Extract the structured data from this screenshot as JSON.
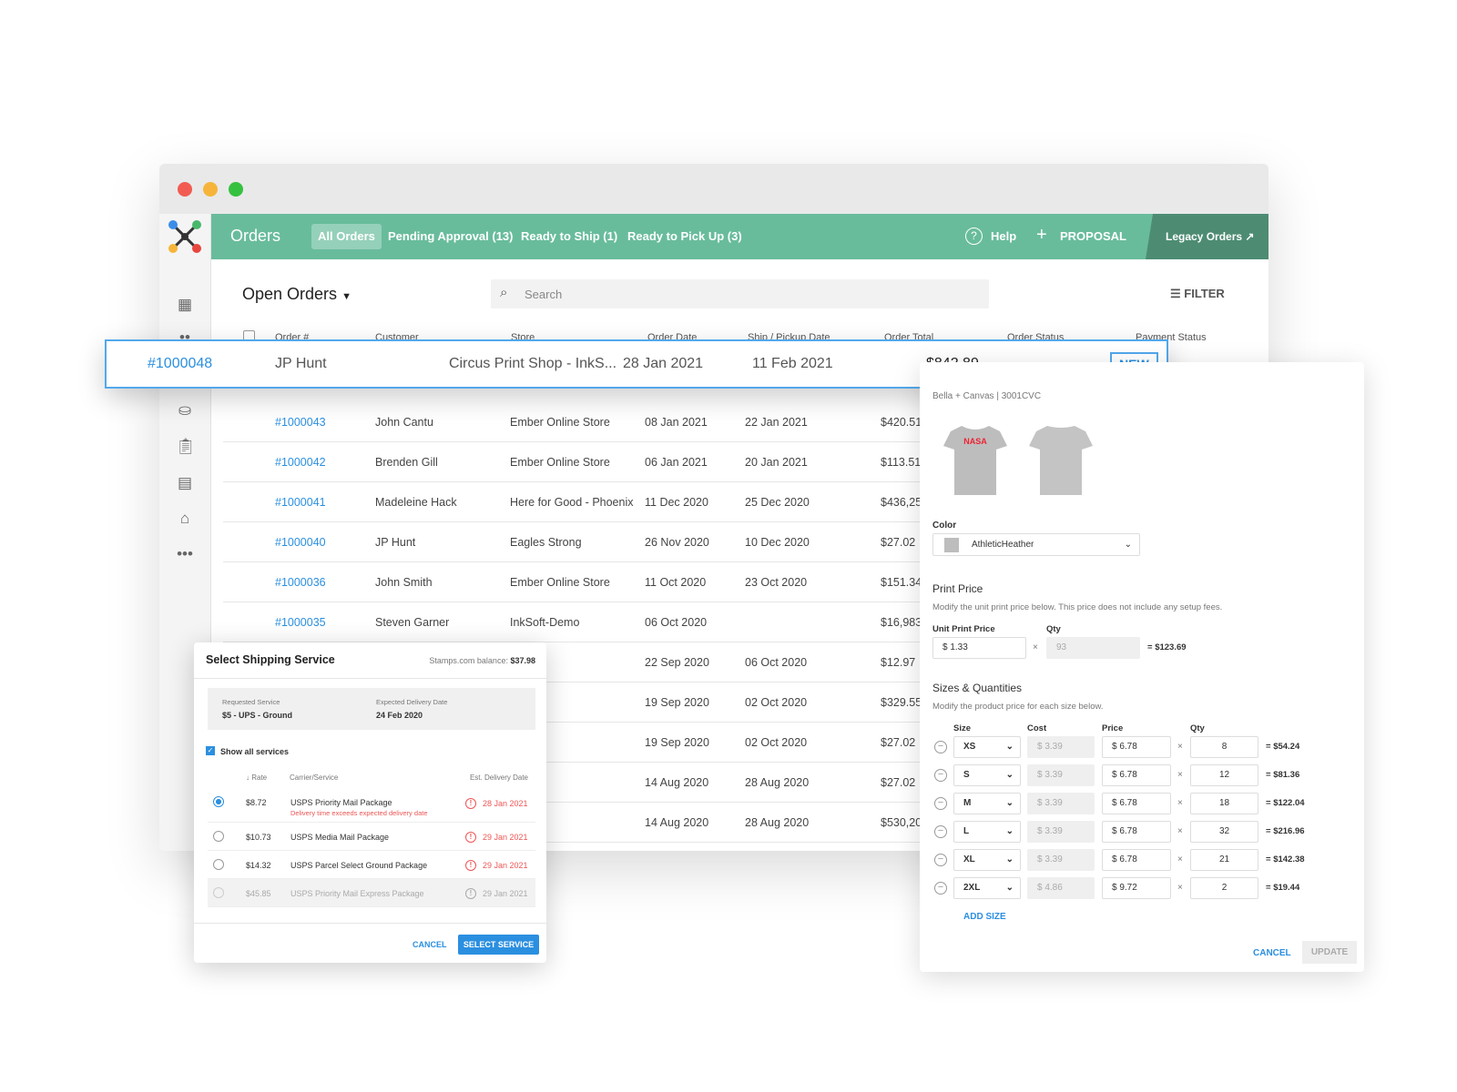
{
  "header": {
    "title": "Orders",
    "tabs": [
      "All Orders",
      "Pending Approval (13)",
      "Ready to Ship (1)",
      "Ready to Pick Up (3)"
    ],
    "help": "Help",
    "proposal": "PROPOSAL",
    "legacy": "Legacy Orders"
  },
  "toolbar": {
    "view": "Open Orders",
    "search_placeholder": "Search",
    "filter": "FILTER"
  },
  "columns": [
    "Order #",
    "Customer",
    "Store",
    "Order Date",
    "Ship / Pickup Date",
    "Order Total",
    "Order Status",
    "Payment Status"
  ],
  "highlight": {
    "order": "#1000048",
    "customer": "JP Hunt",
    "store": "Circus Print Shop - InkS...",
    "order_date": "28 Jan 2021",
    "ship_date": "11 Feb 2021",
    "total": "$842.89",
    "status": "NEW"
  },
  "rows": [
    {
      "order": "#1000043",
      "customer": "John Cantu",
      "store": "Ember Online Store",
      "order_date": "08 Jan 2021",
      "ship_date": "22 Jan 2021",
      "total": "$420.51"
    },
    {
      "order": "#1000042",
      "customer": "Brenden Gill",
      "store": "Ember Online Store",
      "order_date": "06 Jan 2021",
      "ship_date": "20 Jan 2021",
      "total": "$113.51"
    },
    {
      "order": "#1000041",
      "customer": "Madeleine Hack",
      "store": "Here for Good - Phoenix",
      "order_date": "11 Dec 2020",
      "ship_date": "25 Dec 2020",
      "total": "$436,25"
    },
    {
      "order": "#1000040",
      "customer": "JP Hunt",
      "store": "Eagles Strong",
      "order_date": "26 Nov 2020",
      "ship_date": "10 Dec 2020",
      "total": "$27.02"
    },
    {
      "order": "#1000036",
      "customer": "John Smith",
      "store": "Ember Online Store",
      "order_date": "11 Oct 2020",
      "ship_date": "23 Oct 2020",
      "total": "$151.34"
    },
    {
      "order": "#1000035",
      "customer": "Steven Garner",
      "store": "InkSoft-Demo",
      "order_date": "06 Oct 2020",
      "ship_date": "",
      "total": "$16,983"
    },
    {
      "order": "",
      "customer": "",
      "store": "Strong",
      "order_date": "22 Sep 2020",
      "ship_date": "06 Oct 2020",
      "total": "$12.97"
    },
    {
      "order": "",
      "customer": "",
      "store": "Strong",
      "order_date": "19 Sep 2020",
      "ship_date": "02 Oct 2020",
      "total": "$329.55"
    },
    {
      "order": "",
      "customer": "",
      "store": "Strong",
      "order_date": "19 Sep 2020",
      "ship_date": "02 Oct 2020",
      "total": "$27.02"
    },
    {
      "order": "",
      "customer": "",
      "store": "Strong",
      "order_date": "14 Aug 2020",
      "ship_date": "28 Aug 2020",
      "total": "$27.02"
    },
    {
      "order": "",
      "customer": "",
      "store": "Strong",
      "order_date": "14 Aug 2020",
      "ship_date": "28 Aug 2020",
      "total": "$530,20"
    }
  ],
  "shipping": {
    "title": "Select Shipping Service",
    "balance_label": "Stamps.com balance:",
    "balance": "$37.98",
    "req_label": "Requested Service",
    "req_value": "$5 - UPS - Ground",
    "exp_label": "Expected Delivery Date",
    "exp_value": "24 Feb 2020",
    "show_all": "Show all services",
    "cols": [
      "Rate",
      "Carrier/Service",
      "Est. Delivery Date"
    ],
    "services": [
      {
        "rate": "$8.72",
        "name": "USPS Priority Mail Package",
        "note": "Delivery time exceeds expected delivery date",
        "date": "28 Jan 2021",
        "selected": true
      },
      {
        "rate": "$10.73",
        "name": "USPS Media Mail Package",
        "note": "",
        "date": "29 Jan 2021",
        "selected": false
      },
      {
        "rate": "$14.32",
        "name": "USPS Parcel Select Ground Package",
        "note": "",
        "date": "29 Jan 2021",
        "selected": false
      },
      {
        "rate": "$45.85",
        "name": "USPS Priority Mail Express Package",
        "note": "",
        "date": "29 Jan 2021",
        "selected": false,
        "disabled": true
      }
    ],
    "cancel": "CANCEL",
    "select": "SELECT SERVICE"
  },
  "product": {
    "brand": "Bella + Canvas | 3001CVC",
    "shirt_print": "NASA",
    "color_label": "Color",
    "color": "AthleticHeather",
    "color_hex": "#bdbdbd",
    "print_title": "Print Price",
    "print_desc": "Modify the unit print price below. This price does not include any setup fees.",
    "unit_label": "Unit Print Price",
    "qty_label": "Qty",
    "currency": "$",
    "unit_price": "1.33",
    "qty": "93",
    "print_total": "$123.69",
    "sizes_title": "Sizes & Quantities",
    "sizes_desc": "Modify the product price for each size below.",
    "size_cols": [
      "Size",
      "Cost",
      "Price",
      "Qty"
    ],
    "sizes": [
      {
        "size": "XS",
        "cost": "3.39",
        "price": "6.78",
        "qty": "8",
        "total": "$54.24"
      },
      {
        "size": "S",
        "cost": "3.39",
        "price": "6.78",
        "qty": "12",
        "total": "$81.36"
      },
      {
        "size": "M",
        "cost": "3.39",
        "price": "6.78",
        "qty": "18",
        "total": "$122.04"
      },
      {
        "size": "L",
        "cost": "3.39",
        "price": "6.78",
        "qty": "32",
        "total": "$216.96"
      },
      {
        "size": "XL",
        "cost": "3.39",
        "price": "6.78",
        "qty": "21",
        "total": "$142.38"
      },
      {
        "size": "2XL",
        "cost": "4.86",
        "price": "9.72",
        "qty": "2",
        "total": "$19.44"
      }
    ],
    "add_size": "ADD SIZE",
    "cancel": "CANCEL",
    "update": "UPDATE"
  },
  "colors": {
    "accent": "#68bc9c",
    "link": "#2b8fe0"
  }
}
